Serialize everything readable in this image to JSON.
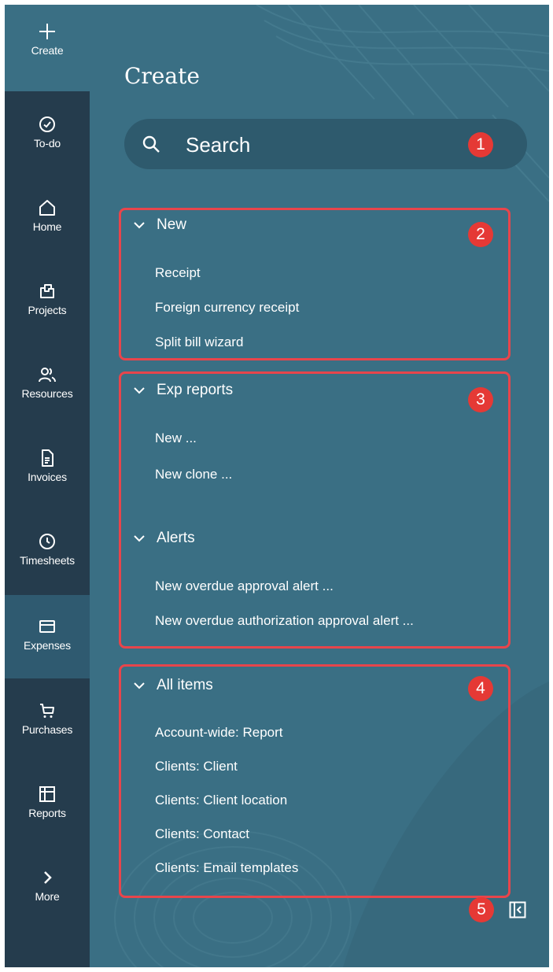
{
  "nav": {
    "items": [
      {
        "label": "Create",
        "icon": "plus-icon"
      },
      {
        "label": "To-do",
        "icon": "check-circle-icon"
      },
      {
        "label": "Home",
        "icon": "home-icon"
      },
      {
        "label": "Projects",
        "icon": "projects-icon"
      },
      {
        "label": "Resources",
        "icon": "people-icon"
      },
      {
        "label": "Invoices",
        "icon": "invoice-icon"
      },
      {
        "label": "Timesheets",
        "icon": "clock-icon"
      },
      {
        "label": "Expenses",
        "icon": "card-icon"
      },
      {
        "label": "Purchases",
        "icon": "cart-icon"
      },
      {
        "label": "Reports",
        "icon": "grid-icon"
      },
      {
        "label": "More",
        "icon": "chevron-right-icon"
      }
    ],
    "active": "Expenses"
  },
  "panel": {
    "title": "Create",
    "search": {
      "label": "Search"
    }
  },
  "sections": {
    "new": {
      "heading": "New",
      "items": [
        "Receipt",
        "Foreign currency receipt",
        "Split bill wizard"
      ]
    },
    "exp_reports": {
      "heading": "Exp reports",
      "items": [
        "New ...",
        "New clone ..."
      ]
    },
    "alerts": {
      "heading": "Alerts",
      "items": [
        "New overdue approval alert ...",
        "New overdue authorization approval alert ..."
      ]
    },
    "all_items": {
      "heading": "All items",
      "items": [
        "Account-wide: Report",
        "Clients: Client",
        "Clients: Client location",
        "Clients: Contact",
        "Clients: Email templates"
      ]
    }
  },
  "callouts": [
    "1",
    "2",
    "3",
    "4",
    "5"
  ],
  "colors": {
    "panel_bg": "#3a6f84",
    "rail_bg": "#253c4d",
    "rail_active": "#2f5a70",
    "search_bg": "#2e5a6d",
    "callout": "#e53935",
    "highlight_border": "#e8454b"
  }
}
